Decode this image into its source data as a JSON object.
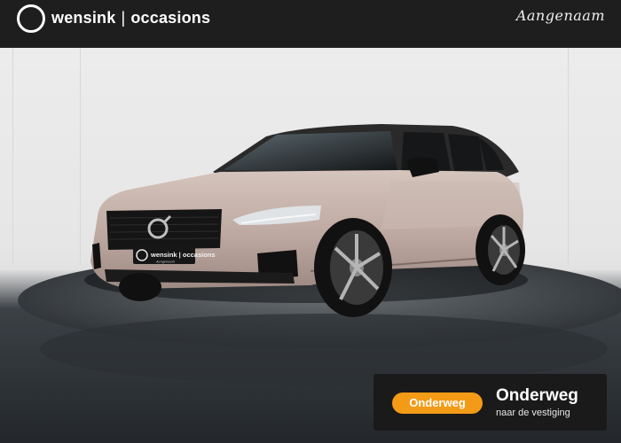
{
  "header": {
    "brand_name": "wensink",
    "brand_separator": "|",
    "brand_product": "occasions",
    "tagline": "Aangenaam",
    "background_color": "#1e1e1e"
  },
  "vehicle": {
    "make_badge_icon": "volvo-badge-icon",
    "paint_color": "#c2aea6",
    "plate_brand": "wensink | occasions",
    "plate_tagline": "Aangenaam"
  },
  "status": {
    "badge_label": "Onderweg",
    "title": "Onderweg",
    "subtitle": "naar de vestiging",
    "accent_color": "#f39a16"
  }
}
